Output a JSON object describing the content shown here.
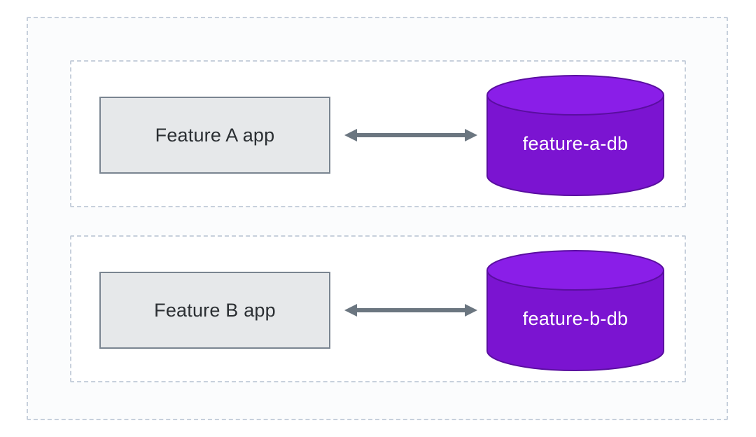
{
  "rows": [
    {
      "app_label": "Feature A app",
      "db_label": "feature-a-db"
    },
    {
      "app_label": "Feature B app",
      "db_label": "feature-b-db"
    }
  ],
  "colors": {
    "db_fill": "#7b14d1",
    "db_stroke": "#5a0ea0",
    "arrow": "#6b7680",
    "box_fill": "#e6e8ea",
    "box_stroke": "#7a8591",
    "dash": "#c7d0dc"
  }
}
